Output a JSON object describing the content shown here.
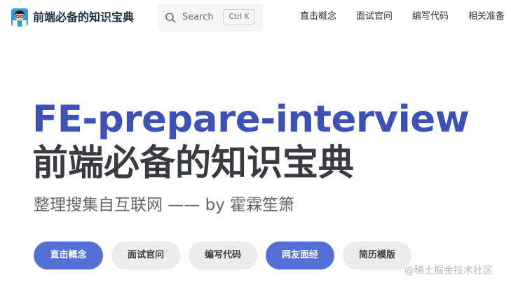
{
  "navbar": {
    "title": "前端必备的知识宝典",
    "logo_icon": "developer-avatar-icon",
    "search": {
      "icon": "search-icon",
      "label": "Search",
      "shortcut": "Ctrl K"
    },
    "links": [
      {
        "label": "直击概念"
      },
      {
        "label": "面试官问"
      },
      {
        "label": "编写代码"
      },
      {
        "label": "相关准备"
      }
    ]
  },
  "hero": {
    "name": "FE-prepare-interview",
    "text": "前端必备的知识宝典",
    "tagline": "整理搜集自互联网 —— by 霍霖笙箫",
    "actions": [
      {
        "label": "直击概念",
        "theme": "brand"
      },
      {
        "label": "面试官问",
        "theme": "alt"
      },
      {
        "label": "编写代码",
        "theme": "alt"
      },
      {
        "label": "网友面经",
        "theme": "brand"
      },
      {
        "label": "简历模版",
        "theme": "alt"
      }
    ]
  },
  "watermark": "@稀土掘金技术社区",
  "colors": {
    "brand": "#3e52b3",
    "button_brand": "#5470d6",
    "button_alt": "#ececef"
  }
}
